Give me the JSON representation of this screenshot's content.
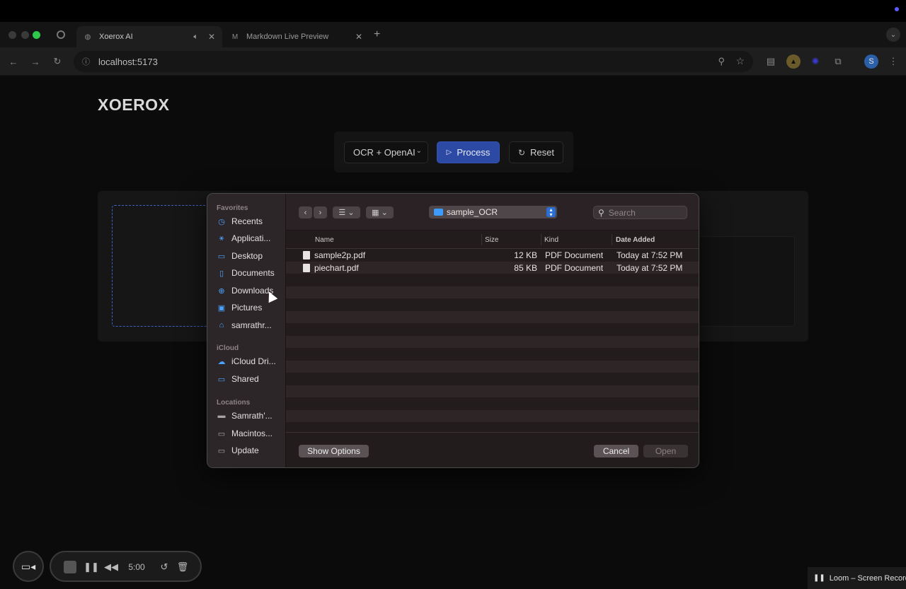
{
  "browser": {
    "tabs": [
      {
        "title": "Xoerox AI",
        "favicon": "globe-icon",
        "active": true
      },
      {
        "title": "Markdown Live Preview",
        "favicon": "M",
        "active": false
      }
    ],
    "new_tab": "+",
    "url": "localhost:5173",
    "profile_initial": "S"
  },
  "app": {
    "brand": "XOEROX",
    "mode_select": "OCR + OpenAI",
    "process_label": "Process",
    "reset_label": "Reset"
  },
  "dialog": {
    "sidebar": {
      "favorites_heading": "Favorites",
      "favorites": [
        {
          "label": "Recents",
          "icon": "clock-icon"
        },
        {
          "label": "Applicati...",
          "icon": "applications-icon"
        },
        {
          "label": "Desktop",
          "icon": "desktop-icon"
        },
        {
          "label": "Documents",
          "icon": "document-icon"
        },
        {
          "label": "Downloads",
          "icon": "download-icon"
        },
        {
          "label": "Pictures",
          "icon": "pictures-icon"
        },
        {
          "label": "samrathr...",
          "icon": "home-icon"
        }
      ],
      "icloud_heading": "iCloud",
      "icloud": [
        {
          "label": "iCloud Dri...",
          "icon": "cloud-icon"
        },
        {
          "label": "Shared",
          "icon": "shared-folder-icon"
        }
      ],
      "locations_heading": "Locations",
      "locations": [
        {
          "label": "Samrath'...",
          "icon": "laptop-icon"
        },
        {
          "label": "Macintos...",
          "icon": "disk-icon"
        },
        {
          "label": "Update",
          "icon": "disk-icon"
        }
      ]
    },
    "current_folder": "sample_OCR",
    "search_placeholder": "Search",
    "columns": {
      "name": "Name",
      "size": "Size",
      "kind": "Kind",
      "date_added": "Date Added"
    },
    "files": [
      {
        "name": "sample2p.pdf",
        "size": "12 KB",
        "kind": "PDF Document",
        "date_added": "Today at 7:52 PM"
      },
      {
        "name": "piechart.pdf",
        "size": "85 KB",
        "kind": "PDF Document",
        "date_added": "Today at 7:52 PM"
      }
    ],
    "show_options_label": "Show Options",
    "cancel_label": "Cancel",
    "open_label": "Open"
  },
  "recorder": {
    "timer": "5:00",
    "loom_label": "Loom – Screen Recorde"
  }
}
